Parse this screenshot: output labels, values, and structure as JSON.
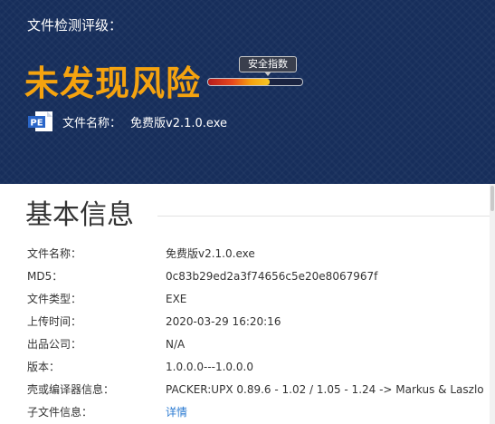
{
  "hero": {
    "grade_label": "文件检测评级：",
    "result": "未发现风险",
    "security_index_label": "安全指数",
    "security_index_level": 0.65,
    "file_name_label": "文件名称：",
    "file_name_value": "免费版v2.1.0.exe",
    "file_icon": "pe-file-icon",
    "file_icon_text": "PE"
  },
  "basic_info": {
    "title": "基本信息",
    "rows": [
      {
        "key": "文件名称：",
        "value": "免费版v2.1.0.exe"
      },
      {
        "key": "MD5：",
        "value": "0c83b29ed2a3f74656c5e20e8067967f"
      },
      {
        "key": "文件类型：",
        "value": "EXE"
      },
      {
        "key": "上传时间：",
        "value": "2020-03-29 16:20:16"
      },
      {
        "key": "出品公司：",
        "value": "N/A"
      },
      {
        "key": "版本：",
        "value": "1.0.0.0---1.0.0.0"
      },
      {
        "key": "壳或编译器信息：",
        "value": "PACKER:UPX 0.89.6 - 1.02 / 1.05 - 1.24 -> Markus & Laszlo"
      },
      {
        "key": "子文件信息：",
        "value": "详情"
      }
    ]
  },
  "colors": {
    "hero_bg": "#172e5b",
    "result_orange": "#f5a30f",
    "link_blue": "#2a7ad2"
  }
}
